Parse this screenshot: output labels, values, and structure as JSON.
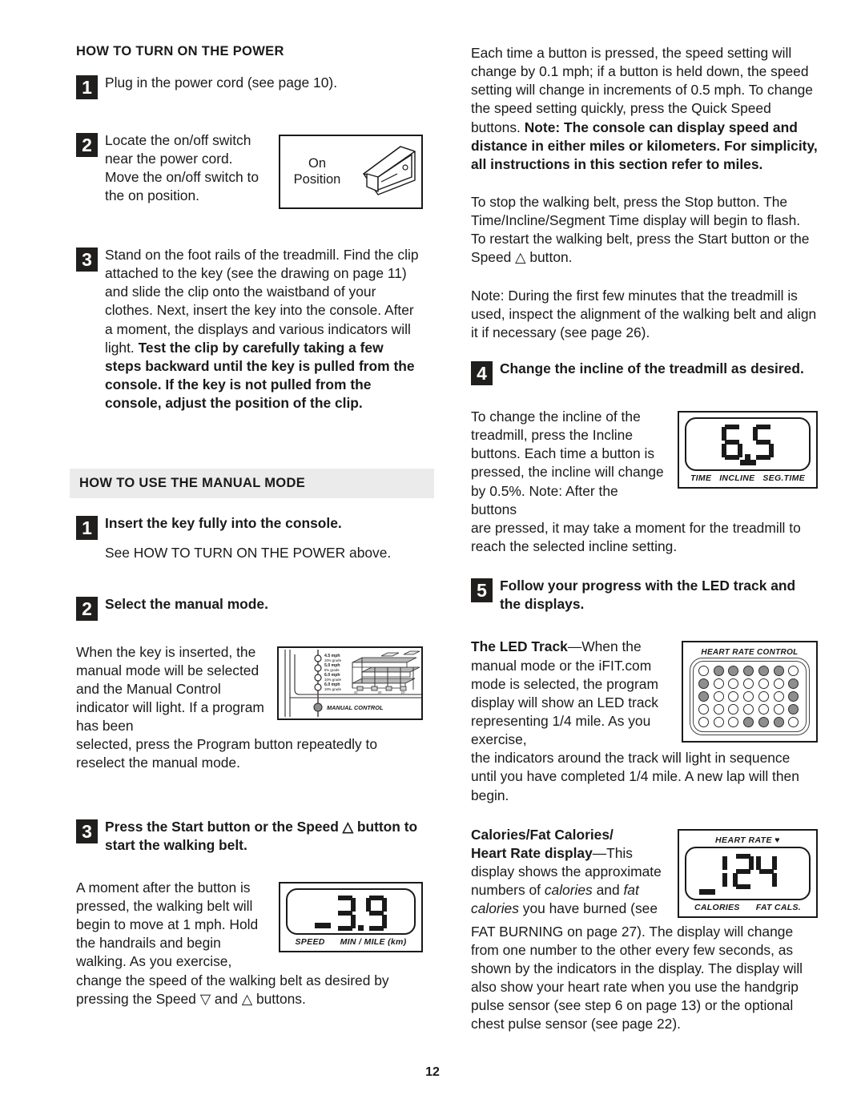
{
  "page": {
    "number": "12"
  },
  "left_column": {
    "section1": {
      "heading": "HOW TO TURN ON THE POWER",
      "banded": false,
      "steps": [
        {
          "number": "1",
          "text": "Plug in the power cord (see page 10)."
        },
        {
          "number": "2",
          "text": "Locate the on/off switch near the power cord. Move the on/off switch to the on position."
        },
        {
          "number": "3",
          "text_plain": "Stand on the foot rails of the treadmill. Find the clip attached to the key (see the drawing on page 11) and slide the clip onto the waistband of your clothes. Next, insert the key into the console. After a moment, the displays and various indicators will light. ",
          "text_bold": "Test the clip by carefully taking a few steps backward until the key is pulled from the console. If the key is not pulled from the console, adjust the position of the clip."
        }
      ],
      "figure_switch": {
        "caption_line1": "On",
        "caption_line2": "Position",
        "icon": "rocker-switch-illustration"
      }
    },
    "section2": {
      "heading": "HOW TO USE THE MANUAL MODE",
      "banded": true,
      "steps": [
        {
          "number": "1",
          "bold_lead": "Insert the key fully into the console.",
          "text": "See HOW TO TURN ON THE POWER above."
        },
        {
          "number": "2",
          "bold_lead": "Select the manual mode.",
          "text_wrap": "When the key is inserted, the manual mode will be selected and the Manual Control indicator will light. If a program has been",
          "text_after": "selected, press the Program button repeatedly to reselect the manual mode."
        },
        {
          "number": "3",
          "bold_lead": "Press the Start button or the Speed △ button to start the walking belt.",
          "text_wrap": "A moment after the button is pressed, the walking belt will begin to move at 1 mph. Hold the handrails and begin walking. As you exercise,",
          "text_after": "change the speed of the walking belt as desired by pressing the Speed ▽ and △ buttons."
        }
      ],
      "figure_program": {
        "indicator_label": "MANUAL CONTROL",
        "program_rows": [
          {
            "speed": "4.5 mph",
            "grade": "10% grade"
          },
          {
            "speed": "5.0 mph",
            "grade": "5% grade"
          },
          {
            "speed": "6.0 mph",
            "grade": "10% grade"
          },
          {
            "speed": "6.0 mph",
            "grade": "10% grade"
          }
        ],
        "axis_ticks": [
          "40",
          "30",
          "20"
        ]
      },
      "figure_speed": {
        "value_digits": [
          "3",
          "9"
        ],
        "decimal": true,
        "underline_under": "SPEED",
        "labels": [
          "SPEED",
          "MIN / MILE (km)"
        ]
      }
    }
  },
  "right_column": {
    "paragraphs": [
      {
        "plain": "Each time a button is pressed, the speed setting will change by 0.1 mph; if a button is held down, the speed setting will change in increments of 0.5 mph. To change the speed setting quickly, press the Quick Speed buttons. ",
        "bold": "Note: The console can display speed and distance in either miles or kilometers. For simplicity, all instructions in this section refer to miles."
      },
      {
        "plain": "To stop the walking belt, press the Stop button. The Time/Incline/Segment Time display will begin to flash. To restart the walking belt, press the Start button or the Speed △ button."
      },
      {
        "plain": "Note: During the first few minutes that the treadmill is used, inspect the alignment of the walking belt and align it if necessary (see page 26)."
      }
    ],
    "steps": [
      {
        "number": "4",
        "bold_lead": "Change the incline of the treadmill as desired.",
        "text_wrap": "To change the incline of the treadmill, press the Incline buttons. Each time a button is pressed, the incline will change by 0.5%. Note: After the buttons",
        "text_after": "are pressed, it may take a moment for the treadmill to reach the selected incline setting."
      },
      {
        "number": "5",
        "bold_lead": "Follow your progress with the LED track and the displays."
      }
    ],
    "led_track": {
      "bold_lead": "The LED Track",
      "dash": "—",
      "text_wrap": "When the manual mode or the iFIT.com mode is selected, the program display will show an LED track representing 1/4 mile. As you exercise,",
      "text_after": "the indicators around the track will light in sequence until you have completed 1/4 mile. A new lap will then begin."
    },
    "figure_incline": {
      "value_digits": [
        "6",
        "5"
      ],
      "decimal": true,
      "underline_under": "INCLINE",
      "labels": [
        "TIME",
        "INCLINE",
        "SEG.TIME"
      ]
    },
    "figure_led": {
      "title": "HEART RATE CONTROL",
      "rows": 5,
      "cols": 7,
      "grid": [
        [
          0,
          1,
          1,
          1,
          1,
          1,
          0
        ],
        [
          1,
          0,
          0,
          0,
          0,
          0,
          1
        ],
        [
          1,
          0,
          0,
          0,
          0,
          0,
          1
        ],
        [
          0,
          0,
          0,
          0,
          0,
          0,
          1
        ],
        [
          0,
          0,
          0,
          1,
          1,
          1,
          0
        ]
      ]
    },
    "calories": {
      "bold_lead_line1": "Calories/Fat Calories/",
      "bold_lead_line2": "Heart Rate display",
      "dash": "—",
      "text_part1": "This display shows the approximate numbers of ",
      "text_italic1": "calories",
      "text_part2": " and ",
      "text_italic2": "fat calories",
      "text_part3": " you have burned (see",
      "text_after": "FAT BURNING on page 27). The display will change from one number to the other every few seconds, as shown by the indicators in the display. The display will also show your heart rate when you use the handgrip pulse sensor (see step 6 on page 13) or the optional chest pulse sensor (see page 22)."
    },
    "figure_heartrate": {
      "title": "HEART RATE",
      "heart_glyph": "♥",
      "value_digits": [
        "1",
        "2",
        "4"
      ],
      "decimal": false,
      "underline_under": "CALORIES",
      "labels": [
        "CALORIES",
        "FAT CALS."
      ]
    }
  },
  "colors": {
    "text": "#1a1a1a",
    "badge_bg": "#211f1e",
    "band_bg": "#ebebeb",
    "led_on": "#8e8e8e"
  }
}
